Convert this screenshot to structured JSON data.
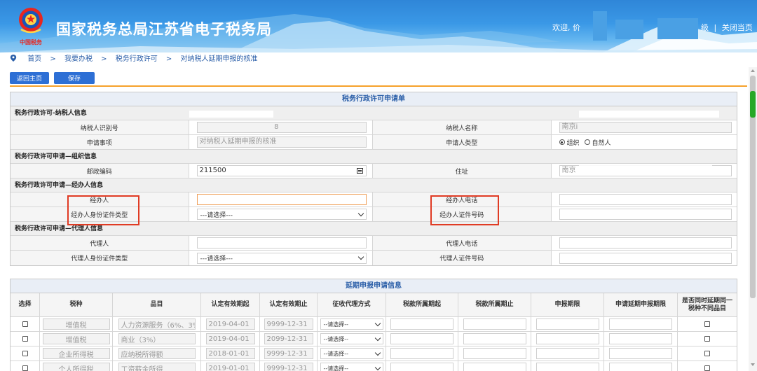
{
  "header": {
    "site_title": "国家税务总局江苏省电子税务局",
    "emblem_text": "中国税务",
    "welcome": "欢迎, 价",
    "link_level_suffix": "级",
    "link_close": "关闭当页",
    "link_sep": "|"
  },
  "breadcrumb": {
    "items": [
      "首页",
      "我要办税",
      "税务行政许可",
      "对纳税人延期申报的核准"
    ],
    "sep": ">"
  },
  "toolbar": {
    "home": "返回主页",
    "save": "保存"
  },
  "form": {
    "title": "税务行政许可申请单",
    "sec_taxpayer": "税务行政许可-纳税人信息",
    "taxpayer_id_label": "纳税人识别号",
    "taxpayer_id_value": "8",
    "taxpayer_name_label": "纳税人名称",
    "taxpayer_name_value": "南京i",
    "apply_item_label": "申请事项",
    "apply_item_value": "对纳税人延期申报的核准",
    "applicant_type_label": "申请人类型",
    "applicant_type_options": [
      "组织",
      "自然人"
    ],
    "sec_org": "税务行政许可申请—组织信息",
    "postcode_label": "邮政编码",
    "postcode_value": "211500",
    "address_label": "住址",
    "address_value": "南京",
    "sec_handler": "税务行政许可申请—经办人信息",
    "handler_label": "经办人",
    "handler_phone_label": "经办人电话",
    "handler_idtype_label": "经办人身份证件类型",
    "handler_idtype_value": "---请选择---",
    "handler_idno_label": "经办人证件号码",
    "sec_agent": "税务行政许可申请—代理人信息",
    "agent_label": "代理人",
    "agent_phone_label": "代理人电话",
    "agent_idtype_label": "代理人身份证件类型",
    "agent_idtype_value": "---请选择---",
    "agent_idno_label": "代理人证件号码"
  },
  "delay": {
    "title": "延期申报申请信息",
    "headers": [
      "选择",
      "税种",
      "品目",
      "认定有效期起",
      "认定有效期止",
      "征收代理方式",
      "税款所属期起",
      "税款所属期止",
      "申报期限",
      "申请延期申报期限",
      "是否同时延期同一税种不同品目"
    ],
    "rows": [
      {
        "tax": "增值税",
        "item": "人力资源服务（6%、3%",
        "from": "2019-04-01",
        "to": "9999-12-31",
        "mode": "--请选择--"
      },
      {
        "tax": "增值税",
        "item": "商业（3%）",
        "from": "2019-04-01",
        "to": "2099-12-31",
        "mode": "--请选择--"
      },
      {
        "tax": "企业所得税",
        "item": "应纳税所得额",
        "from": "2018-01-01",
        "to": "9999-12-31",
        "mode": "--请选择--"
      },
      {
        "tax": "个人所得税",
        "item": "工资薪金所得",
        "from": "2019-01-01",
        "to": "9999-12-31",
        "mode": "--请选择--"
      }
    ]
  }
}
